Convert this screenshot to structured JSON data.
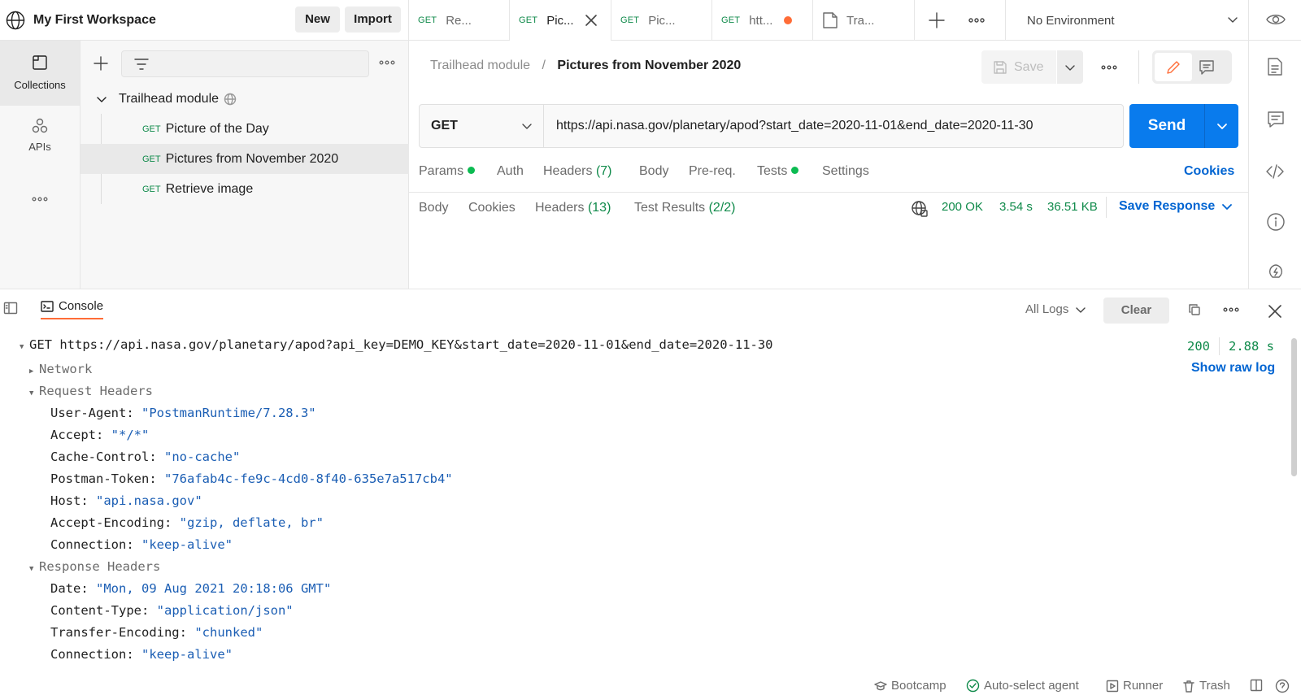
{
  "header": {
    "workspace_title": "My First Workspace",
    "new_label": "New",
    "import_label": "Import",
    "tabs": [
      {
        "method": "GET",
        "title": "Re..."
      },
      {
        "method": "GET",
        "title": "Pic..."
      },
      {
        "method": "GET",
        "title": "Pic..."
      },
      {
        "method": "GET",
        "title": "htt..."
      },
      {
        "method": "",
        "title": "Tra..."
      }
    ],
    "environment": "No Environment"
  },
  "rail": {
    "collections_label": "Collections",
    "apis_label": "APIs"
  },
  "sidebar": {
    "collection_name": "Trailhead module",
    "requests": [
      {
        "method": "GET",
        "name": "Picture of the Day"
      },
      {
        "method": "GET",
        "name": "Pictures from November 2020"
      },
      {
        "method": "GET",
        "name": "Retrieve image"
      }
    ]
  },
  "request": {
    "breadcrumb_parent": "Trailhead module",
    "breadcrumb_separator": "/",
    "breadcrumb_current": "Pictures from November 2020",
    "save_label": "Save",
    "method": "GET",
    "url": "https://api.nasa.gov/planetary/apod?start_date=2020-11-01&end_date=2020-11-30",
    "send_label": "Send",
    "tabs": {
      "params": "Params",
      "auth": "Auth",
      "headers": "Headers",
      "headers_count": "(7)",
      "body": "Body",
      "prereq": "Pre-req.",
      "tests": "Tests",
      "settings": "Settings"
    },
    "cookies_label": "Cookies"
  },
  "response": {
    "tabs": {
      "body": "Body",
      "cookies": "Cookies",
      "headers": "Headers",
      "headers_count": "(13)",
      "test_results": "Test Results",
      "test_count": "(2/2)"
    },
    "status": "200 OK",
    "time": "3.54 s",
    "size": "36.51 KB",
    "save_response_label": "Save Response"
  },
  "console": {
    "tab_label": "Console",
    "filter": "All Logs",
    "clear_label": "Clear",
    "request_line": "GET https://api.nasa.gov/planetary/apod?api_key=DEMO_KEY&start_date=2020-11-01&end_date=2020-11-30",
    "status_code": "200",
    "duration": "2.88 s",
    "show_raw_log": "Show raw log",
    "network_label": "Network",
    "request_headers_label": "Request Headers",
    "request_headers": [
      {
        "key": "User-Agent:",
        "value": "\"PostmanRuntime/7.28.3\""
      },
      {
        "key": "Accept:",
        "value": "\"*/*\""
      },
      {
        "key": "Cache-Control:",
        "value": "\"no-cache\""
      },
      {
        "key": "Postman-Token:",
        "value": "\"76afab4c-fe9c-4cd0-8f40-635e7a517cb4\""
      },
      {
        "key": "Host:",
        "value": "\"api.nasa.gov\""
      },
      {
        "key": "Accept-Encoding:",
        "value": "\"gzip, deflate, br\""
      },
      {
        "key": "Connection:",
        "value": "\"keep-alive\""
      }
    ],
    "response_headers_label": "Response Headers",
    "response_headers": [
      {
        "key": "Date:",
        "value": "\"Mon, 09 Aug 2021 20:18:06 GMT\""
      },
      {
        "key": "Content-Type:",
        "value": "\"application/json\""
      },
      {
        "key": "Transfer-Encoding:",
        "value": "\"chunked\""
      },
      {
        "key": "Connection:",
        "value": "\"keep-alive\""
      }
    ]
  },
  "statusbar": {
    "bootcamp": "Bootcamp",
    "agent": "Auto-select agent",
    "runner": "Runner",
    "trash": "Trash"
  },
  "colors": {
    "accent": "#097bed",
    "get_method": "#0f8a4a",
    "unsaved_dot": "#ff6c37",
    "value_text": "#1b5eb4",
    "active_dot": "#0cbb52"
  }
}
